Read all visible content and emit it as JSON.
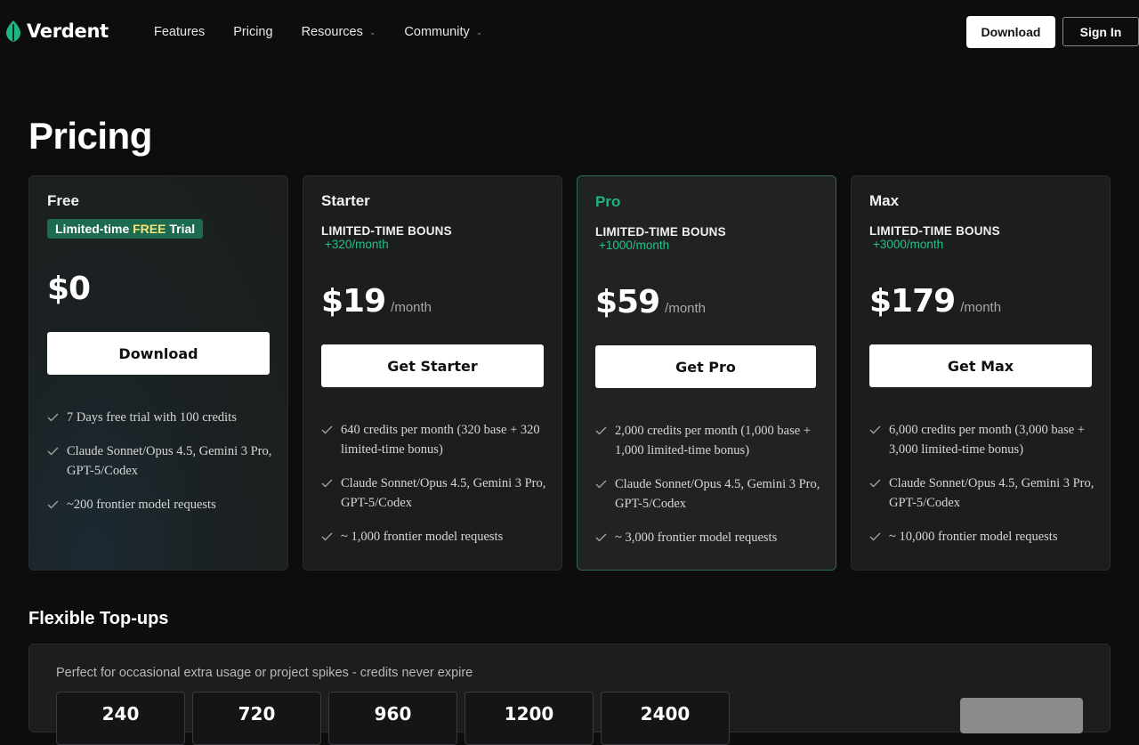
{
  "brand": {
    "name": "Verdent",
    "accent": "#1db584"
  },
  "nav": {
    "links": [
      {
        "label": "Features",
        "dropdown": false
      },
      {
        "label": "Pricing",
        "dropdown": false
      },
      {
        "label": "Resources",
        "dropdown": true
      },
      {
        "label": "Community",
        "dropdown": true
      }
    ],
    "download_label": "Download",
    "signin_label": "Sign In"
  },
  "page": {
    "title": "Pricing"
  },
  "plans": [
    {
      "name": "Free",
      "badge": {
        "prefix": "Limited-time ",
        "highlight": "FREE",
        "suffix": " Trial"
      },
      "price": "$0",
      "period": "",
      "cta": "Download",
      "features": [
        "7 Days free trial with 100 credits",
        "Claude Sonnet/Opus 4.5, Gemini 3 Pro, GPT-5/Codex",
        "~200 frontier model requests"
      ]
    },
    {
      "name": "Starter",
      "bonus_label": "LIMITED-TIME BOUNS",
      "bonus_value": "+320/month",
      "price": "$19",
      "period": "/month",
      "cta": "Get Starter",
      "features": [
        "640 credits per month (320 base + 320 limited-time bonus)",
        "Claude Sonnet/Opus 4.5, Gemini 3 Pro, GPT-5/Codex",
        "~ 1,000 frontier model requests"
      ]
    },
    {
      "name": "Pro",
      "bonus_label": "LIMITED-TIME BOUNS",
      "bonus_value": "+1000/month",
      "price": "$59",
      "period": "/month",
      "cta": "Get Pro",
      "features": [
        "2,000 credits per month (1,000 base + 1,000 limited-time bonus)",
        "Claude Sonnet/Opus 4.5, Gemini 3 Pro, GPT-5/Codex",
        "~ 3,000 frontier model requests"
      ]
    },
    {
      "name": "Max",
      "bonus_label": "LIMITED-TIME BOUNS",
      "bonus_value": "+3000/month",
      "price": "$179",
      "period": "/month",
      "cta": "Get Max",
      "features": [
        "6,000 credits per month (3,000 base + 3,000 limited-time bonus)",
        "Claude Sonnet/Opus 4.5, Gemini 3 Pro, GPT-5/Codex",
        "~ 10,000 frontier model requests"
      ]
    }
  ],
  "topups": {
    "title": "Flexible Top-ups",
    "description": "Perfect for occasional extra usage or project spikes - credits never expire",
    "options": [
      "240",
      "720",
      "960",
      "1200",
      "2400"
    ]
  },
  "icons": {
    "feature": "check-icon",
    "dropdown": "chevron-down-icon",
    "logo": "leaf-logo-icon"
  }
}
